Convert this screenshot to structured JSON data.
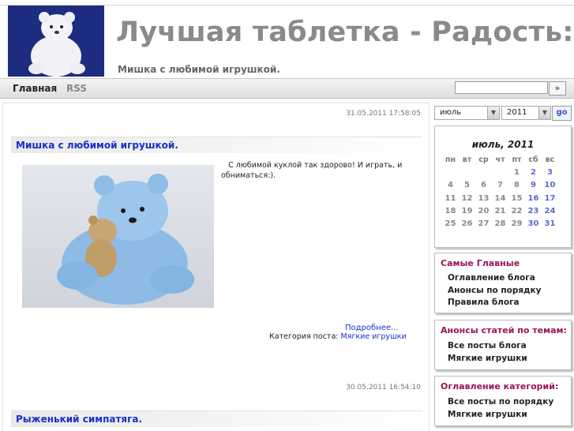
{
  "site": {
    "title": "Лучшая таблетка - Радость:)",
    "subtitle": "Мишка с любимой игрушкой."
  },
  "nav": {
    "home": "Главная",
    "rss": "RSS",
    "search_value": "",
    "search_button": "»"
  },
  "posts": [
    {
      "date": "31.05.2011 17:58:05",
      "title": "Мишка с любимой игрушкой.",
      "text": "С любимой куклой так здорово! И играть, и обниматься:).",
      "more": "Подробнее...",
      "category_label": "Категория поста:",
      "category": "Мягкие игрушки"
    },
    {
      "date": "30.05.2011 16:54:10",
      "title": "Рыженький симпатяга."
    }
  ],
  "calendar": {
    "month_select": "июль",
    "year_select": "2011",
    "go": "go",
    "title": "июль, 2011",
    "weekdays": [
      "пн",
      "вт",
      "ср",
      "чт",
      "пт",
      "сб",
      "вс"
    ],
    "weeks": [
      [
        "",
        "",
        "",
        "",
        "1",
        "2",
        "3"
      ],
      [
        "4",
        "5",
        "6",
        "7",
        "8",
        "9",
        "10"
      ],
      [
        "11",
        "12",
        "13",
        "14",
        "15",
        "16",
        "17"
      ],
      [
        "18",
        "19",
        "20",
        "21",
        "22",
        "23",
        "24"
      ],
      [
        "25",
        "26",
        "27",
        "28",
        "29",
        "30",
        "31"
      ]
    ]
  },
  "sidebar": {
    "main": {
      "title": "Самые Главные",
      "items": [
        "Оглавление блога",
        "Анонсы по порядку",
        "Правила блога"
      ]
    },
    "announces": {
      "title": "Анонсы статей по темам:",
      "items": [
        "Все посты блога",
        "Мягкие игрушки"
      ]
    },
    "categories": {
      "title": "Оглавление категорий:",
      "items": [
        "Все посты по порядку",
        "Мягкие игрушки"
      ]
    }
  }
}
